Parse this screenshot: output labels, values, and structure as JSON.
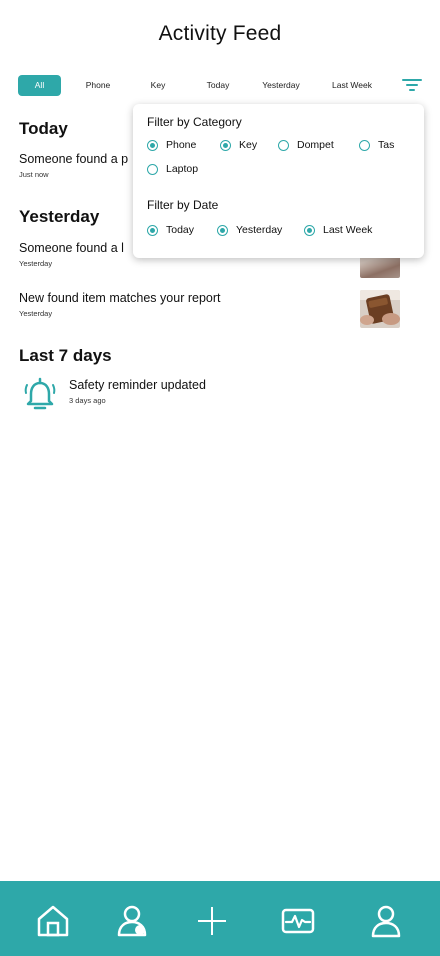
{
  "header": {
    "title": "Activity Feed"
  },
  "chips": [
    {
      "label": "All",
      "active": true
    },
    {
      "label": "Phone"
    },
    {
      "label": "Key"
    },
    {
      "label": "Today"
    },
    {
      "label": "Yesterday"
    },
    {
      "label": "Last Week"
    }
  ],
  "filter_icon": "filter-icon",
  "feed": {
    "today": {
      "title": "Today",
      "items": [
        {
          "title": "Someone found a p",
          "time": "Just now"
        }
      ]
    },
    "yesterday": {
      "title": "Yesterday",
      "items": [
        {
          "title": "Someone found a l",
          "time": "Yesterday"
        },
        {
          "title": "New found item matches your report",
          "time": "Yesterday"
        }
      ]
    },
    "last7": {
      "title": "Last 7 days",
      "items": [
        {
          "title": "Safety reminder updated",
          "time": "3 days ago",
          "icon": "bell-icon"
        }
      ]
    }
  },
  "filter_popup": {
    "category_heading": "Filter by Category",
    "categories": [
      {
        "label": "Phone",
        "checked": true
      },
      {
        "label": "Key",
        "checked": true
      },
      {
        "label": "Dompet",
        "checked": false
      },
      {
        "label": "Tas",
        "checked": false
      },
      {
        "label": "Laptop",
        "checked": false
      }
    ],
    "date_heading": "Filter by Date",
    "dates": [
      {
        "label": "Today",
        "checked": true
      },
      {
        "label": "Yesterday",
        "checked": true
      },
      {
        "label": "Last Week",
        "checked": true
      }
    ]
  },
  "bottom_nav": {
    "items": [
      "home-icon",
      "contacts-icon",
      "add-icon",
      "activity-icon",
      "profile-icon"
    ]
  },
  "colors": {
    "accent": "#2ea8a9",
    "text": "#111111",
    "background": "#ffffff"
  }
}
